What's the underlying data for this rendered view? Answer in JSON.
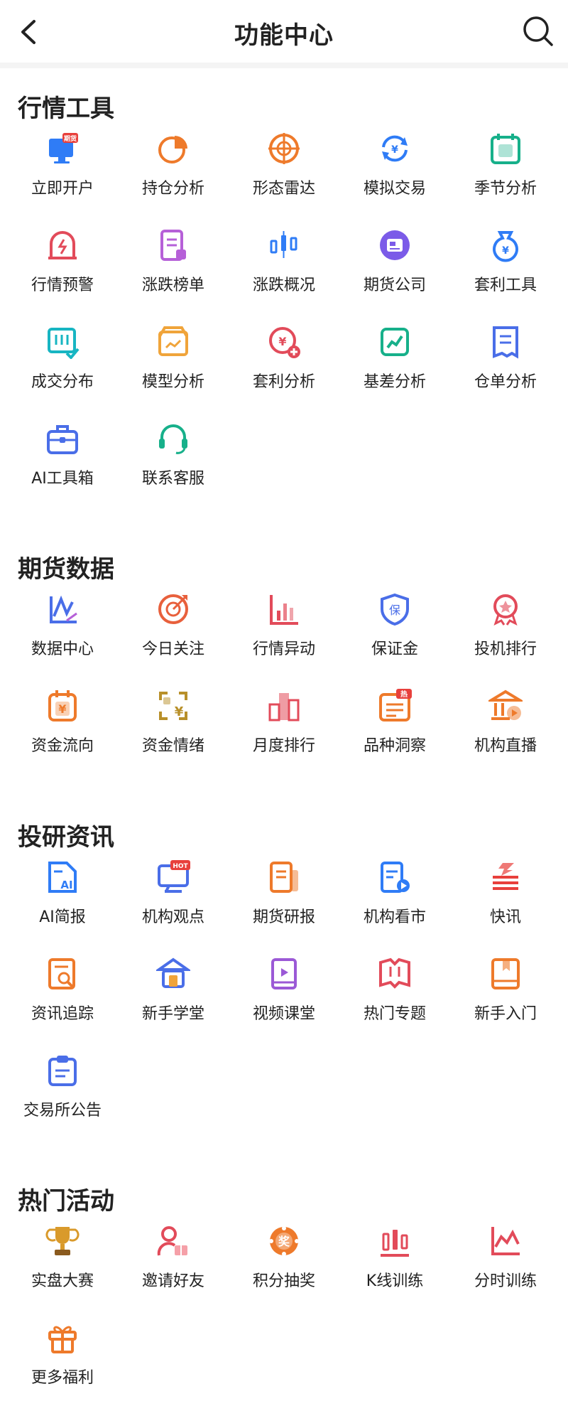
{
  "header": {
    "title": "功能中心"
  },
  "sections": [
    {
      "title": "行情工具",
      "items": [
        {
          "label": "立即开户",
          "icon": "open-account-icon",
          "badge": "期货"
        },
        {
          "label": "持仓分析",
          "icon": "pie-chart-icon"
        },
        {
          "label": "形态雷达",
          "icon": "radar-target-icon"
        },
        {
          "label": "模拟交易",
          "icon": "exchange-icon"
        },
        {
          "label": "季节分析",
          "icon": "calendar-season-icon"
        },
        {
          "label": "行情预警",
          "icon": "alarm-bell-icon"
        },
        {
          "label": "涨跌榜单",
          "icon": "list-doc-icon"
        },
        {
          "label": "涨跌概况",
          "icon": "candlestick-icon"
        },
        {
          "label": "期货公司",
          "icon": "company-icon"
        },
        {
          "label": "套利工具",
          "icon": "money-bag-icon"
        },
        {
          "label": "成交分布",
          "icon": "distribution-icon"
        },
        {
          "label": "模型分析",
          "icon": "model-box-icon"
        },
        {
          "label": "套利分析",
          "icon": "arbitrage-plus-icon"
        },
        {
          "label": "基差分析",
          "icon": "trend-chart-icon"
        },
        {
          "label": "仓单分析",
          "icon": "warehouse-receipt-icon"
        },
        {
          "label": "AI工具箱",
          "icon": "toolbox-icon"
        },
        {
          "label": "联系客服",
          "icon": "headset-icon"
        }
      ]
    },
    {
      "title": "期货数据",
      "items": [
        {
          "label": "数据中心",
          "icon": "data-center-icon"
        },
        {
          "label": "今日关注",
          "icon": "target-arrow-icon"
        },
        {
          "label": "行情异动",
          "icon": "bar-chart-icon"
        },
        {
          "label": "保证金",
          "icon": "shield-icon"
        },
        {
          "label": "投机排行",
          "icon": "award-icon"
        },
        {
          "label": "资金流向",
          "icon": "fund-flow-icon"
        },
        {
          "label": "资金情绪",
          "icon": "fund-mood-icon"
        },
        {
          "label": "月度排行",
          "icon": "podium-icon"
        },
        {
          "label": "品种洞察",
          "icon": "insight-icon",
          "badge": "热"
        },
        {
          "label": "机构直播",
          "icon": "institution-live-icon"
        }
      ]
    },
    {
      "title": "投研资讯",
      "items": [
        {
          "label": "AI简报",
          "icon": "ai-report-icon"
        },
        {
          "label": "机构观点",
          "icon": "opinion-screen-icon",
          "badge": "HOT"
        },
        {
          "label": "期货研报",
          "icon": "research-doc-icon"
        },
        {
          "label": "机构看市",
          "icon": "market-view-icon"
        },
        {
          "label": "快讯",
          "icon": "flash-news-icon"
        },
        {
          "label": "资讯追踪",
          "icon": "news-track-icon"
        },
        {
          "label": "新手学堂",
          "icon": "school-icon"
        },
        {
          "label": "视频课堂",
          "icon": "video-book-icon"
        },
        {
          "label": "热门专题",
          "icon": "open-book-icon"
        },
        {
          "label": "新手入门",
          "icon": "bookmark-book-icon"
        },
        {
          "label": "交易所公告",
          "icon": "clipboard-icon"
        }
      ]
    },
    {
      "title": "热门活动",
      "items": [
        {
          "label": "实盘大赛",
          "icon": "trophy-icon"
        },
        {
          "label": "邀请好友",
          "icon": "invite-gift-icon"
        },
        {
          "label": "积分抽奖",
          "icon": "lottery-icon",
          "badge": "奖"
        },
        {
          "label": "K线训练",
          "icon": "kline-training-icon"
        },
        {
          "label": "分时训练",
          "icon": "intraday-training-icon"
        },
        {
          "label": "更多福利",
          "icon": "gift-icon"
        }
      ]
    }
  ]
}
